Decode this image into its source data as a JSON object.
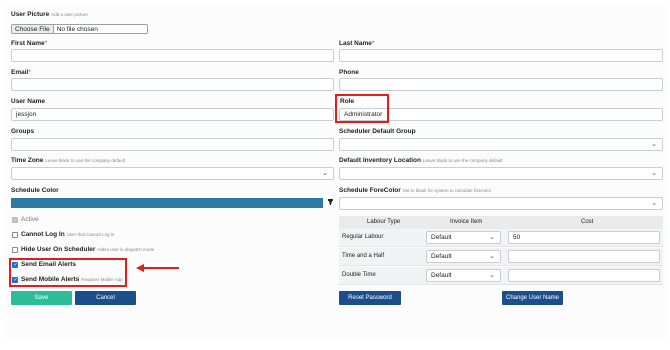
{
  "user_picture": {
    "label": "User Picture",
    "hint": "Add a user picture",
    "choose_label": "Choose File",
    "file_status": "No file chosen"
  },
  "fields": {
    "first_name": {
      "label": "First Name",
      "required": "*",
      "value": ""
    },
    "last_name": {
      "label": "Last Name",
      "required": "*",
      "value": ""
    },
    "email": {
      "label": "Email",
      "required": "*",
      "value": ""
    },
    "phone": {
      "label": "Phone",
      "value": ""
    },
    "user_name": {
      "label": "User Name",
      "value": "jessjon"
    },
    "role": {
      "label": "Role",
      "value": "Administrator"
    },
    "groups": {
      "label": "Groups",
      "value": ""
    },
    "scheduler_default_group": {
      "label": "Scheduler Default Group",
      "value": ""
    },
    "time_zone": {
      "label": "Time Zone",
      "hint": "Leave blank to use the company default",
      "value": ""
    },
    "default_inventory_location": {
      "label": "Default Inventory Location",
      "hint": "Leave blank to use the company default",
      "value": ""
    },
    "schedule_color": {
      "label": "Schedule Color",
      "color": "#2d7aa6"
    },
    "schedule_forecolor": {
      "label": "Schedule ForeColor",
      "hint": "Set to blank for system to calculate forecolor",
      "value": ""
    }
  },
  "checkboxes": {
    "active": {
      "label": "Active",
      "checked": true,
      "disabled": true
    },
    "cannot_log_in": {
      "label": "Cannot Log In",
      "hint": "User that Cannot Log In",
      "checked": false
    },
    "hide_user_on_scheduler": {
      "label": "Hide User On Scheduler",
      "hint": "Hides user in dispatch mode",
      "checked": false
    },
    "send_email_alerts": {
      "label": "Send Email Alerts",
      "checked": true
    },
    "send_mobile_alerts": {
      "label": "Send Mobile Alerts",
      "hint": "Requires Mobile App",
      "checked": true
    }
  },
  "buttons": {
    "save": "Save",
    "cancel": "Cancel",
    "reset_password": "Reset Password",
    "change_user_name": "Change User Name"
  },
  "labour_table": {
    "headers": [
      "Labour Type",
      "Invoice Item",
      "Cost"
    ],
    "rows": [
      {
        "type": "Regular Labour",
        "invoice_item": "Default",
        "cost": "50"
      },
      {
        "type": "Time and a Half",
        "invoice_item": "Default",
        "cost": ""
      },
      {
        "type": "Double Time",
        "invoice_item": "Default",
        "cost": ""
      }
    ]
  },
  "colors": {
    "accent_green": "#2fbc9a",
    "accent_navy": "#1c4e8c",
    "highlight_red": "#e01e1e"
  },
  "icons": {
    "eyedropper": "eyedropper-icon",
    "chevron": "chevron-down-icon",
    "arrow": "red-arrow-annotation"
  }
}
